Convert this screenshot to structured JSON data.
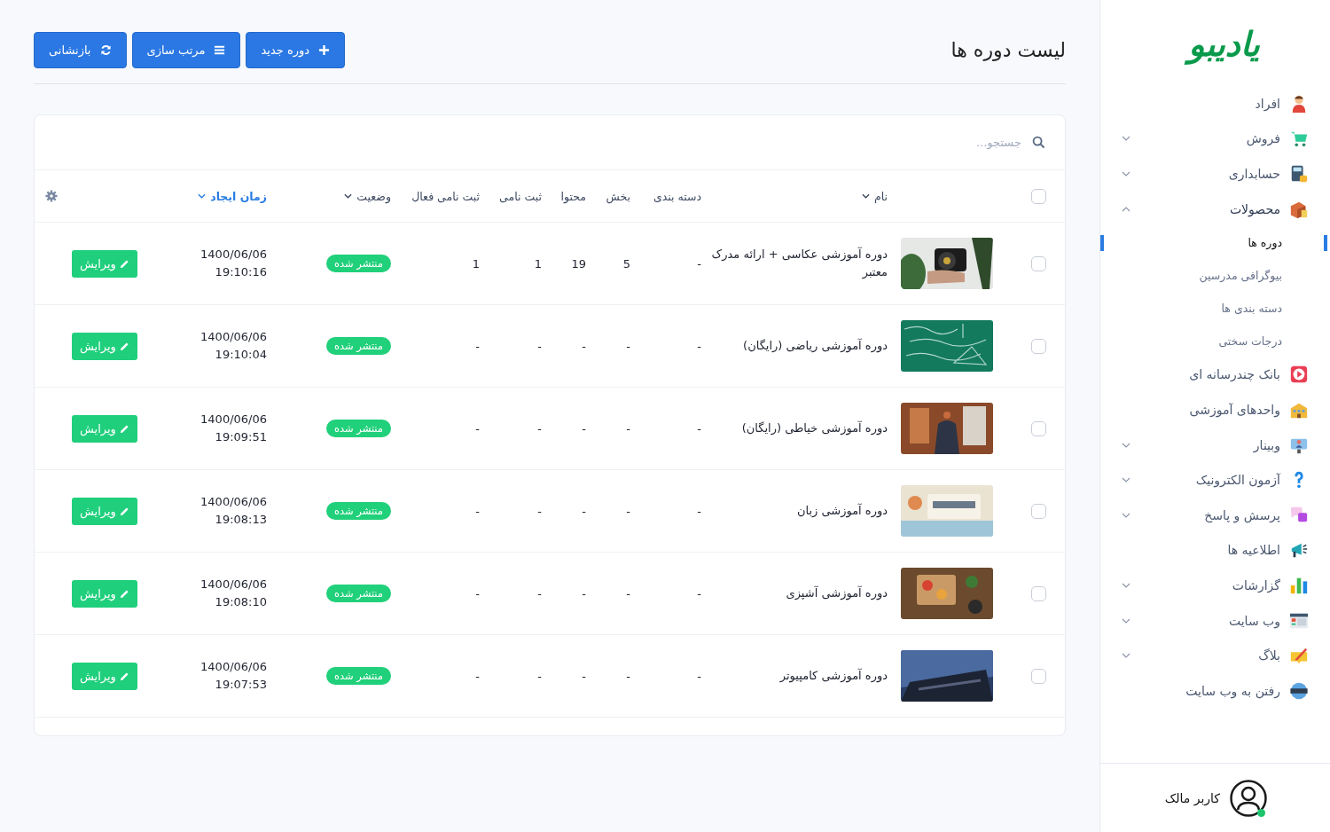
{
  "sidebar": {
    "logo": "یادیبو",
    "items": [
      {
        "label": "افراد",
        "kind": "link"
      },
      {
        "label": "فروش",
        "kind": "group",
        "expanded": false
      },
      {
        "label": "حسابداری",
        "kind": "group",
        "expanded": false
      },
      {
        "label": "محصولات",
        "kind": "group",
        "expanded": true,
        "children": [
          {
            "label": "دوره ها",
            "selected": true
          },
          {
            "label": "بیوگرافی مدرسین",
            "selected": false
          },
          {
            "label": "دسته بندی ها",
            "selected": false
          },
          {
            "label": "درجات سختی",
            "selected": false
          }
        ]
      },
      {
        "label": "بانک چندرسانه ای",
        "kind": "link"
      },
      {
        "label": "واحدهای آموزشی",
        "kind": "link"
      },
      {
        "label": "وبینار",
        "kind": "group",
        "expanded": false
      },
      {
        "label": "آزمون الکترونیک",
        "kind": "group",
        "expanded": false
      },
      {
        "label": "پرسش و پاسخ",
        "kind": "group",
        "expanded": false
      },
      {
        "label": "اطلاعیه ها",
        "kind": "link"
      },
      {
        "label": "گزارشات",
        "kind": "group",
        "expanded": false
      },
      {
        "label": "وب سایت",
        "kind": "group",
        "expanded": false
      },
      {
        "label": "بلاگ",
        "kind": "group",
        "expanded": false
      },
      {
        "label": "رفتن به وب سایت",
        "kind": "link"
      }
    ],
    "user": {
      "name": "کاربر مالک",
      "online": true
    }
  },
  "page": {
    "title": "لیست دوره ها",
    "buttons": [
      "دوره جدید",
      "مرتب سازی",
      "بازنشانی"
    ]
  },
  "table": {
    "search": {
      "placeholder": "جستجو..."
    },
    "select_all": {
      "checked": false
    },
    "columns": [
      {
        "label": "نام",
        "sortable": true,
        "sorted": false
      },
      {
        "label": "دسته بندی",
        "sortable": false,
        "sorted": false
      },
      {
        "label": "بخش",
        "sortable": false,
        "sorted": false
      },
      {
        "label": "محتوا",
        "sortable": false,
        "sorted": false
      },
      {
        "label": "ثبت نامی",
        "sortable": false,
        "sorted": false
      },
      {
        "label": "ثبت نامی فعال",
        "sortable": false,
        "sorted": false
      },
      {
        "label": "وضعیت",
        "sortable": true,
        "sorted": false
      },
      {
        "label": "زمان ایجاد",
        "sortable": true,
        "sorted": true
      }
    ],
    "rows": [
      {
        "checked": false,
        "name": "دوره آموزشی عکاسی + ارائه مدرک معتبر",
        "category": "-",
        "section": "5",
        "content": "19",
        "registrations": "1",
        "active_registrations": "1",
        "status": "منتشر شده",
        "published": true,
        "date": "1400/06/06",
        "time": "19:10:16",
        "edit": "ویرایش"
      },
      {
        "checked": false,
        "name": "دوره آموزشی ریاضی (رایگان)",
        "category": "-",
        "section": "-",
        "content": "-",
        "registrations": "-",
        "active_registrations": "-",
        "status": "منتشر شده",
        "published": true,
        "date": "1400/06/06",
        "time": "19:10:04",
        "edit": "ویرایش"
      },
      {
        "checked": false,
        "name": "دوره آموزشی خیاطی (رایگان)",
        "category": "-",
        "section": "-",
        "content": "-",
        "registrations": "-",
        "active_registrations": "-",
        "status": "منتشر شده",
        "published": true,
        "date": "1400/06/06",
        "time": "19:09:51",
        "edit": "ویرایش"
      },
      {
        "checked": false,
        "name": "دوره آموزشی زبان",
        "category": "-",
        "section": "-",
        "content": "-",
        "registrations": "-",
        "active_registrations": "-",
        "status": "منتشر شده",
        "published": true,
        "date": "1400/06/06",
        "time": "19:08:13",
        "edit": "ویرایش"
      },
      {
        "checked": false,
        "name": "دوره آموزشی آشپزی",
        "category": "-",
        "section": "-",
        "content": "-",
        "registrations": "-",
        "active_registrations": "-",
        "status": "منتشر شده",
        "published": true,
        "date": "1400/06/06",
        "time": "19:08:10",
        "edit": "ویرایش"
      },
      {
        "checked": false,
        "name": "دوره آموزشی کامپیوتر",
        "category": "-",
        "section": "-",
        "content": "-",
        "registrations": "-",
        "active_registrations": "-",
        "status": "منتشر شده",
        "published": true,
        "date": "1400/06/06",
        "time": "19:07:53",
        "edit": "ویرایش"
      }
    ]
  }
}
